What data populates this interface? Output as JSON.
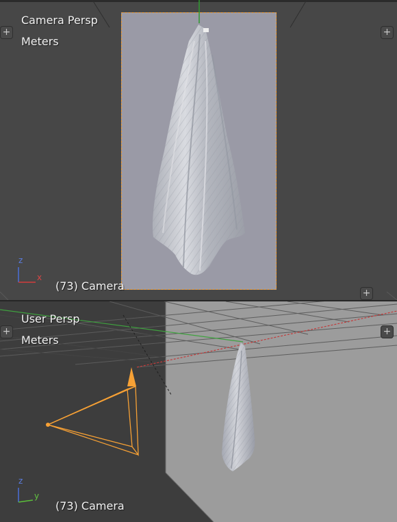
{
  "top_viewport": {
    "view_name": "Camera Persp",
    "units": "Meters",
    "object_info": "(73) Camera",
    "axis_labels": {
      "z": "z",
      "x": "x"
    }
  },
  "bottom_viewport": {
    "view_name": "User Persp",
    "units": "Meters",
    "object_info": "(73) Camera",
    "axis_labels": {
      "z": "z",
      "y": "y"
    }
  },
  "controls": {
    "toolbar_toggle": "+",
    "properties_toggle": "+",
    "corner_widget": "+"
  },
  "colors": {
    "viewport_bg": "#474747",
    "camera_frame_bg": "#9a9aa6",
    "selection_orange": "#f7a135",
    "axis_x": "#d33d3d",
    "axis_y": "#5bbf3a",
    "axis_z": "#4a6fd8",
    "cloth": "#c8cad0"
  }
}
